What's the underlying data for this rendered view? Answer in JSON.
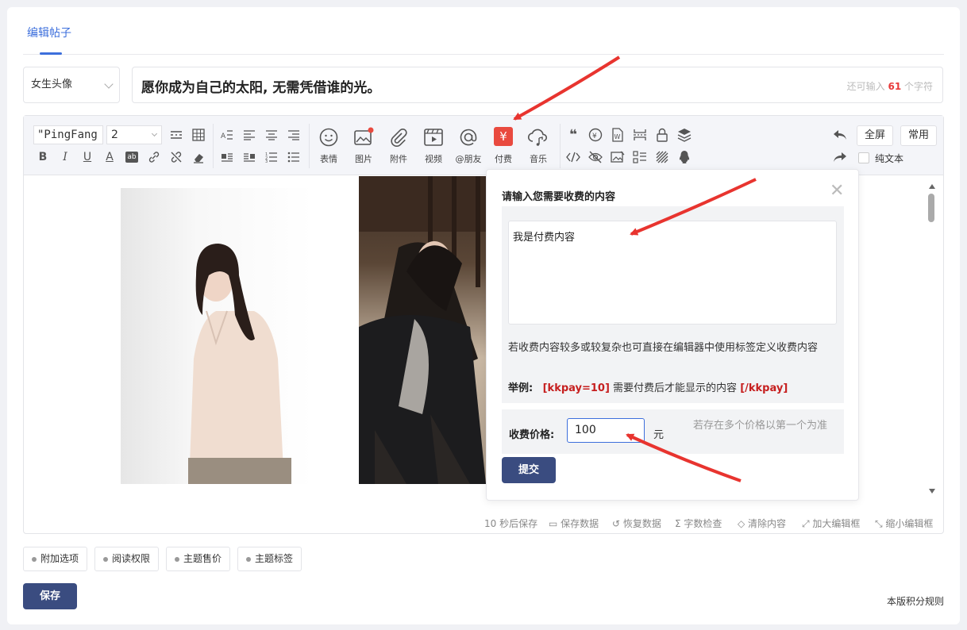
{
  "tabs": {
    "active": "编辑帖子"
  },
  "category": {
    "selected": "女生头像"
  },
  "title": {
    "value": "愿你成为自己的太阳, 无需凭借谁的光。",
    "remaining_prefix": "还可输入 ",
    "remaining_count": "61",
    "remaining_suffix": " 个字符"
  },
  "toolbar": {
    "font_family": "\"PingFang S",
    "font_size": "2",
    "buttons": {
      "emoji": "表情",
      "image": "图片",
      "attachment": "附件",
      "video": "视频",
      "mention": "@朋友",
      "pay": "付费",
      "music": "音乐"
    },
    "fullscreen": "全屏",
    "common": "常用",
    "plain_text": "纯文本",
    "pay_symbol": "¥"
  },
  "popup": {
    "title": "请输入您需要收费的内容",
    "content_value": "我是付费内容",
    "hint": "若收费内容较多或较复杂也可直接在编辑器中使用标签定义收费内容",
    "example_label": "举例:",
    "example_open": "[kkpay=10]",
    "example_mid": " 需要付费后才能显示的内容 ",
    "example_close": "[/kkpay]",
    "price_label": "收费价格:",
    "price_value": "100",
    "price_unit": "元",
    "price_note": "若存在多个价格以第一个为准",
    "submit": "提交"
  },
  "statusbar": {
    "autosave": "10 秒后保存",
    "save_data": "保存数据",
    "restore_data": "恢复数据",
    "word_check": "字数检查",
    "clear_content": "清除内容",
    "enlarge": "加大编辑框",
    "shrink": "缩小编辑框"
  },
  "options": [
    "附加选项",
    "阅读权限",
    "主题售价",
    "主题标签"
  ],
  "actions": {
    "save": "保存",
    "rules": "本版积分规则"
  },
  "colors": {
    "accent": "#3d6fdc",
    "primary_btn": "#3a4c80",
    "pay_icon": "#e94a3f",
    "red_text": "#c61f1f",
    "arrow": "#e8342f"
  }
}
